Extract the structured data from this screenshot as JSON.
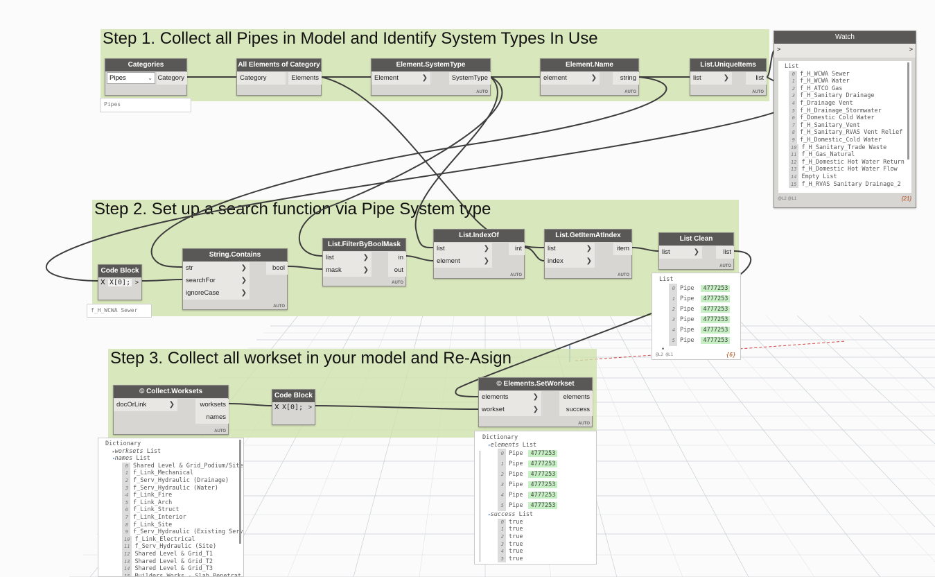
{
  "groups": {
    "step1": "Step 1. Collect all Pipes in Model and Identify System Types In Use",
    "step2": "Step 2. Set up a search function via Pipe System type",
    "step3": "Step 3. Collect all workset in your model and Re-Asign"
  },
  "nodes": {
    "categories": {
      "title": "Categories",
      "dropdown": "Pipes",
      "out": "Category",
      "input_value": "Pipes"
    },
    "all_elements": {
      "title": "All Elements of Category",
      "in": "Category",
      "out": "Elements"
    },
    "system_type": {
      "title": "Element.SystemType",
      "in": "Element",
      "out": "SystemType",
      "auto": "AUTO"
    },
    "element_name": {
      "title": "Element.Name",
      "in": "element",
      "out": "string",
      "auto": "AUTO"
    },
    "unique_items": {
      "title": "List.UniqueItems",
      "in": "list",
      "out": "list",
      "auto": "AUTO"
    },
    "code_block_1": {
      "title": "Code Block",
      "code": "X[0];",
      "x": "X",
      "arrow": ">",
      "preview": "f_H_WCWA Sewer"
    },
    "string_contains": {
      "title": "String.Contains",
      "in1": "str",
      "in2": "searchFor",
      "in3": "ignoreCase",
      "out": "bool",
      "auto": "AUTO"
    },
    "filter_mask": {
      "title": "List.FilterByBoolMask",
      "in1": "list",
      "in2": "mask",
      "out1": "in",
      "out2": "out",
      "auto": "AUTO"
    },
    "index_of": {
      "title": "List.IndexOf",
      "in1": "list",
      "in2": "element",
      "out": "int",
      "auto": "AUTO"
    },
    "get_item": {
      "title": "List.GetItemAtIndex",
      "in1": "list",
      "in2": "index",
      "out": "item",
      "auto": "AUTO"
    },
    "list_clean": {
      "title": "List Clean",
      "in": "list",
      "out": "list",
      "auto": "AUTO"
    },
    "collect_worksets": {
      "title": "© Collect.Worksets",
      "in": "docOrLink",
      "out1": "worksets",
      "out2": "names",
      "auto": "AUTO"
    },
    "code_block_2": {
      "title": "Code Block",
      "code": "X[0];",
      "x": "X",
      "arrow": ">"
    },
    "set_workset": {
      "title": "© Elements.SetWorkset",
      "in1": "elements",
      "in2": "workset",
      "out1": "elements",
      "out2": "success",
      "auto": "AUTO"
    }
  },
  "watch": {
    "title": "Watch",
    "in_arrow": ">",
    "out_arrow": ">",
    "header": "List",
    "items": [
      {
        "i": "0",
        "v": "f_H_WCWA Sewer"
      },
      {
        "i": "1",
        "v": "f_H_WCWA Water"
      },
      {
        "i": "2",
        "v": "f_H_ATCO Gas"
      },
      {
        "i": "3",
        "v": "f_H_Sanitary Drainage"
      },
      {
        "i": "4",
        "v": "f_Drainage Vent"
      },
      {
        "i": "5",
        "v": "f_H_Drainage_Stormwater"
      },
      {
        "i": "6",
        "v": "f_Domestic Cold Water"
      },
      {
        "i": "7",
        "v": "f_H_Sanitary_Vent"
      },
      {
        "i": "8",
        "v": "f_H_Sanitary_RVAS Vent Relief"
      },
      {
        "i": "9",
        "v": "f_H_Domestic_Cold Water"
      },
      {
        "i": "10",
        "v": "f_H_Sanitary_Trade Waste"
      },
      {
        "i": "11",
        "v": "f_H_Gas_Natural"
      },
      {
        "i": "12",
        "v": "f_H_Domestic Hot Water Return"
      },
      {
        "i": "13",
        "v": "f_H_Domestic Hot Water Flow"
      },
      {
        "i": "14",
        "v": "Empty List"
      },
      {
        "i": "15",
        "v": "f_H_RVAS Sanitary Drainage_2"
      }
    ],
    "levels": "@L2 @L1",
    "count": "{21}"
  },
  "list_clean_preview": {
    "header": "List",
    "rows": [
      {
        "i": "0",
        "t": "Pipe",
        "v": "4777253"
      },
      {
        "i": "1",
        "t": "Pipe",
        "v": "4777253"
      },
      {
        "i": "2",
        "t": "Pipe",
        "v": "4777253"
      },
      {
        "i": "3",
        "t": "Pipe",
        "v": "4777253"
      },
      {
        "i": "4",
        "t": "Pipe",
        "v": "4777253"
      },
      {
        "i": "5",
        "t": "Pipe",
        "v": "4777253"
      }
    ],
    "levels": "@L2 @L1",
    "count": "{6}"
  },
  "worksets_preview": {
    "header": "Dictionary",
    "worksets_key": "worksets",
    "worksets_type": "List",
    "names_key": "names",
    "names_type": "List",
    "names": [
      {
        "i": "0",
        "v": "Shared Level & Grid_Podium/Site"
      },
      {
        "i": "1",
        "v": "f_Link_Mechanical"
      },
      {
        "i": "2",
        "v": "f_Serv_Hydraulic (Drainage)"
      },
      {
        "i": "3",
        "v": "f_Serv_Hydraulic (Water)"
      },
      {
        "i": "4",
        "v": "f_Link_Fire"
      },
      {
        "i": "5",
        "v": "f_Link_Arch"
      },
      {
        "i": "6",
        "v": "f_Link_Struct"
      },
      {
        "i": "7",
        "v": "f_Link_Interior"
      },
      {
        "i": "8",
        "v": "f_Link_Site"
      },
      {
        "i": "9",
        "v": "f_Serv_Hydraulic (Existing Serv"
      },
      {
        "i": "10",
        "v": "f_Link_Electrical"
      },
      {
        "i": "11",
        "v": "f_Serv_Hydraulic (Site)"
      },
      {
        "i": "12",
        "v": "Shared Level & Grid_T1"
      },
      {
        "i": "13",
        "v": "Shared Level & Grid_T2"
      },
      {
        "i": "14",
        "v": "Shared Level & Grid_T3"
      },
      {
        "i": "15",
        "v": "Builders Works - Slab Penetrat"
      }
    ]
  },
  "setworkset_preview": {
    "header": "Dictionary",
    "elements_key": "elements",
    "elements_type": "List",
    "success_key": "success",
    "success_type": "List",
    "elements": [
      {
        "i": "0",
        "t": "Pipe",
        "v": "4777253"
      },
      {
        "i": "1",
        "t": "Pipe",
        "v": "4777253"
      },
      {
        "i": "2",
        "t": "Pipe",
        "v": "4777253"
      },
      {
        "i": "3",
        "t": "Pipe",
        "v": "4777253"
      },
      {
        "i": "4",
        "t": "Pipe",
        "v": "4777253"
      },
      {
        "i": "5",
        "t": "Pipe",
        "v": "4777253"
      }
    ],
    "success": [
      {
        "i": "0",
        "v": "true"
      },
      {
        "i": "1",
        "v": "true"
      },
      {
        "i": "2",
        "v": "true"
      },
      {
        "i": "3",
        "v": "true"
      },
      {
        "i": "4",
        "v": "true"
      },
      {
        "i": "5",
        "v": "true"
      }
    ]
  },
  "colors": {
    "group": "#d0e2aa",
    "node_header": "#5a5856",
    "wire": "#3d3d3d",
    "highlight": "#c6f0c4"
  }
}
